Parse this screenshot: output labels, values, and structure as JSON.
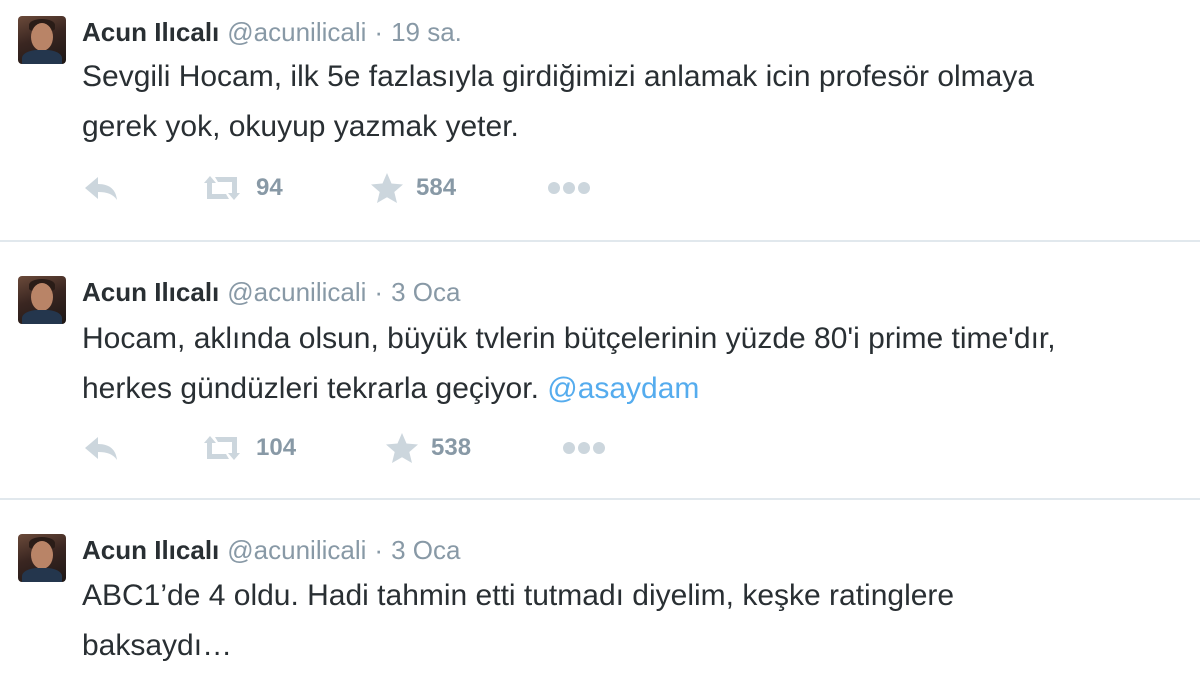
{
  "tweets": [
    {
      "name": "Acun Ilıcalı",
      "handle": "@acunilicali",
      "separator": "·",
      "time": "19 sa.",
      "text_lines": [
        "Sevgili Hocam, ilk 5e fazlasıyla girdiğimizi anlamak icin profesör olmaya",
        "gerek yok, okuyup yazmak yeter."
      ],
      "mention": "",
      "retweets": "94",
      "favorites": "584"
    },
    {
      "name": "Acun Ilıcalı",
      "handle": "@acunilicali",
      "separator": "·",
      "time": "3 Oca",
      "text_lines": [
        "Hocam, aklında olsun, büyük tvlerin bütçelerinin yüzde 80'i prime time'dır,",
        "herkes gündüzleri tekrarla geçiyor. "
      ],
      "mention": "@asaydam",
      "retweets": "104",
      "favorites": "538"
    },
    {
      "name": "Acun Ilıcalı",
      "handle": "@acunilicali",
      "separator": "·",
      "time": "3 Oca",
      "text_lines": [
        "ABC1’de 4 oldu. Hadi tahmin etti tutmadı diyelim, keşke ratinglere",
        "baksaydı…"
      ],
      "mention": "",
      "retweets": "",
      "favorites": ""
    }
  ],
  "icons": {
    "reply": "reply-icon",
    "retweet": "retweet-icon",
    "favorite": "star-icon",
    "more": "more-icon"
  },
  "colors": {
    "name": "#292f33",
    "meta": "#8899a6",
    "mention": "#55acee",
    "action_icon": "#ccd6dd",
    "divider": "#e1e8ed"
  }
}
